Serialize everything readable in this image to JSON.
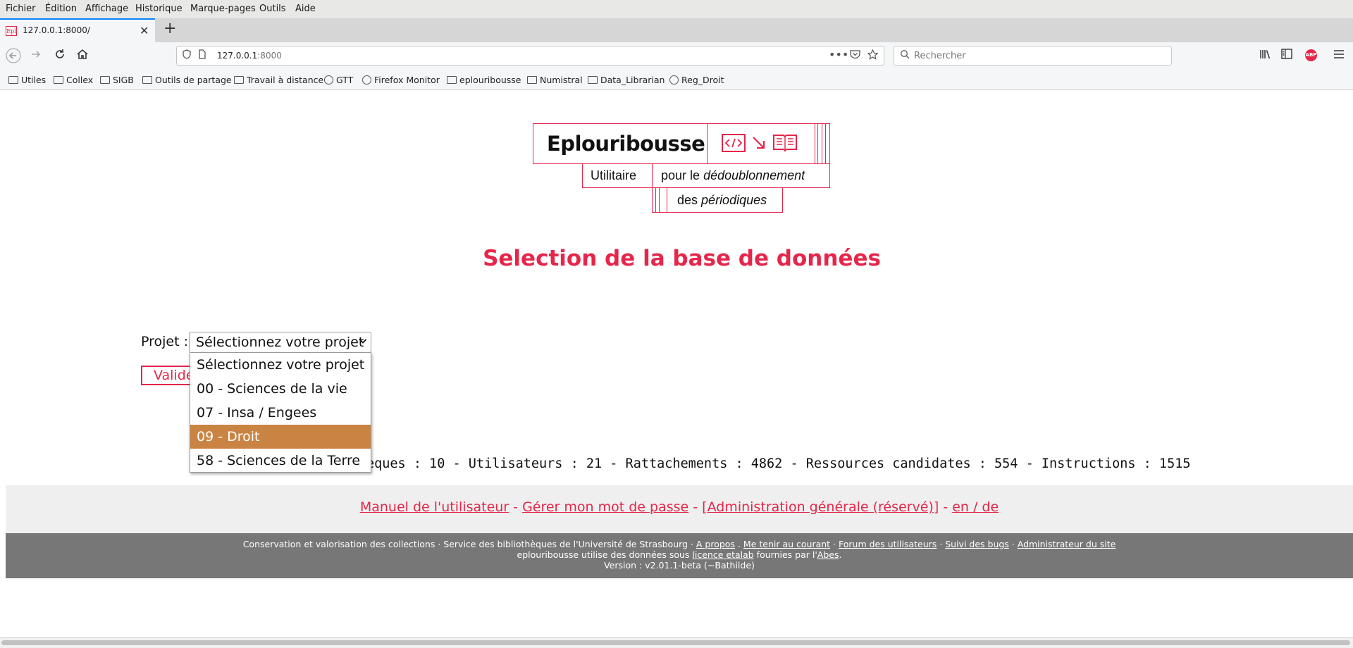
{
  "menubar": {
    "items": [
      {
        "label": "Fichier"
      },
      {
        "label": "Édition"
      },
      {
        "label": "Affichage"
      },
      {
        "label": "Historique"
      },
      {
        "label": "Marque-pages"
      },
      {
        "label": "Outils"
      },
      {
        "label": "Aide"
      }
    ]
  },
  "tab": {
    "favicon": "Epl",
    "title": "127.0.0.1:8000/",
    "close": "✕",
    "new": "+"
  },
  "navbar": {
    "url_host": "127.0.0.1",
    "url_port": ":8000",
    "search_placeholder": "Rechercher",
    "abp": "ABP"
  },
  "bookmarks": [
    {
      "label": "Utiles",
      "icon": "folder-icon"
    },
    {
      "label": "Collex",
      "icon": "folder-icon"
    },
    {
      "label": "SIGB",
      "icon": "folder-icon"
    },
    {
      "label": "Outils de partage",
      "icon": "folder-icon"
    },
    {
      "label": "Travail à distance",
      "icon": "folder-icon"
    },
    {
      "label": "GTT",
      "icon": "globe-icon"
    },
    {
      "label": "Firefox Monitor",
      "icon": "globe-icon"
    },
    {
      "label": "eplouribousse",
      "icon": "folder-icon"
    },
    {
      "label": "Numistral",
      "icon": "folder-icon"
    },
    {
      "label": "Data_Librarian",
      "icon": "folder-icon"
    },
    {
      "label": "Reg_Droit",
      "icon": "globe-icon"
    }
  ],
  "logo": {
    "title": "Eplouribousse",
    "utilitaire": "Utilitaire",
    "pour_le": "pour le",
    "dedoublonnement": "dédoublonnement",
    "des": "des",
    "periodiques": "périodiques"
  },
  "heading": "Selection de la base de données",
  "form": {
    "projet_label": "Projet :",
    "selected": "Sélectionnez votre projet",
    "validate_label": "Valider",
    "options": [
      {
        "label": "Sélectionnez votre projet"
      },
      {
        "label": "00 - Sciences de la vie"
      },
      {
        "label": "07 - Insa / Engees"
      },
      {
        "label": "09 - Droit"
      },
      {
        "label": "58 - Sciences de la Terre"
      }
    ],
    "highlighted_option": "09 - Droit"
  },
  "stats_text": "eques : 10 - Utilisateurs : 21 - Rattachements : 4862 - Ressources candidates : 554 - Instructions : 1515",
  "links": {
    "manuel": "Manuel de l'utilisateur",
    "mot_de_passe": "Gérer mon mot de passe",
    "admin": "[Administration générale (réservé)]",
    "lang": "en / de",
    "sep": " - "
  },
  "footer": {
    "line1_prefix": "Conservation et valorisation des collections · Service des bibliothèques de l'Université de Strasbourg · ",
    "a_propos": "A propos",
    "sep1": " . ",
    "tenir": "Me tenir au courant",
    "sep2": " · ",
    "forum": "Forum des utilisateurs",
    "sep3": " · ",
    "bugs": "Suivi des bugs",
    "sep4": " · ",
    "admin_site": "Administrateur du site",
    "line2_prefix": "eplouribousse utilise des données sous ",
    "licence": "licence etalab",
    "line2_mid": " fournies par l'",
    "abes": "Abes",
    "line2_end": ".",
    "version": "Version : v2.01.1-beta (~Bathilde)"
  },
  "colors": {
    "accent": "#e5264a",
    "highlight": "#c98443",
    "footer_bg": "#777777",
    "links_bg": "#efefef"
  }
}
